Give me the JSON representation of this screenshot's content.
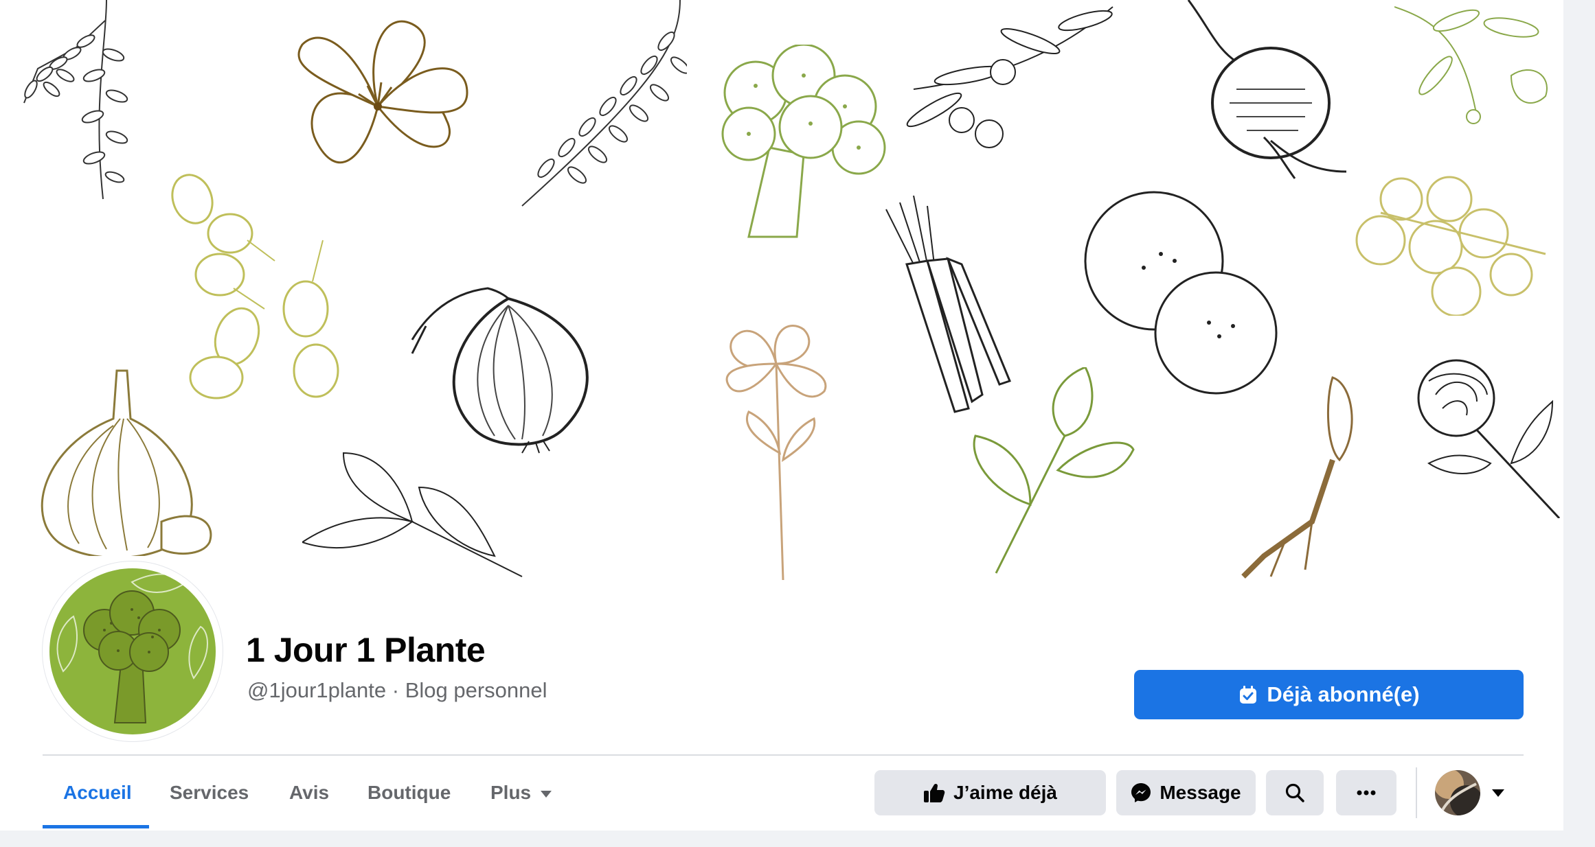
{
  "page": {
    "name": "1 Jour 1 Plante",
    "handle": "@1jour1plante",
    "separator": "·",
    "category": "Blog personnel"
  },
  "buttons": {
    "subscribed": "Déjà abonné(e)",
    "like": "J’aime déjà",
    "message": "Message"
  },
  "tabs": [
    {
      "label": "Accueil",
      "active": true
    },
    {
      "label": "Services",
      "active": false
    },
    {
      "label": "Avis",
      "active": false
    },
    {
      "label": "Boutique",
      "active": false
    },
    {
      "label": "Plus",
      "active": false
    }
  ],
  "icons": {
    "subscribe": "calendar-check-icon",
    "like": "thumbs-up-icon",
    "message": "messenger-icon",
    "search": "search-icon",
    "more": "more-horizontal-icon",
    "dropdown": "chevron-down-icon"
  },
  "colors": {
    "accent": "#1b74e4",
    "secondary_button": "#e4e6eb",
    "avatar_green": "#8db43c",
    "text_primary": "#050505",
    "text_secondary": "#65676b"
  }
}
